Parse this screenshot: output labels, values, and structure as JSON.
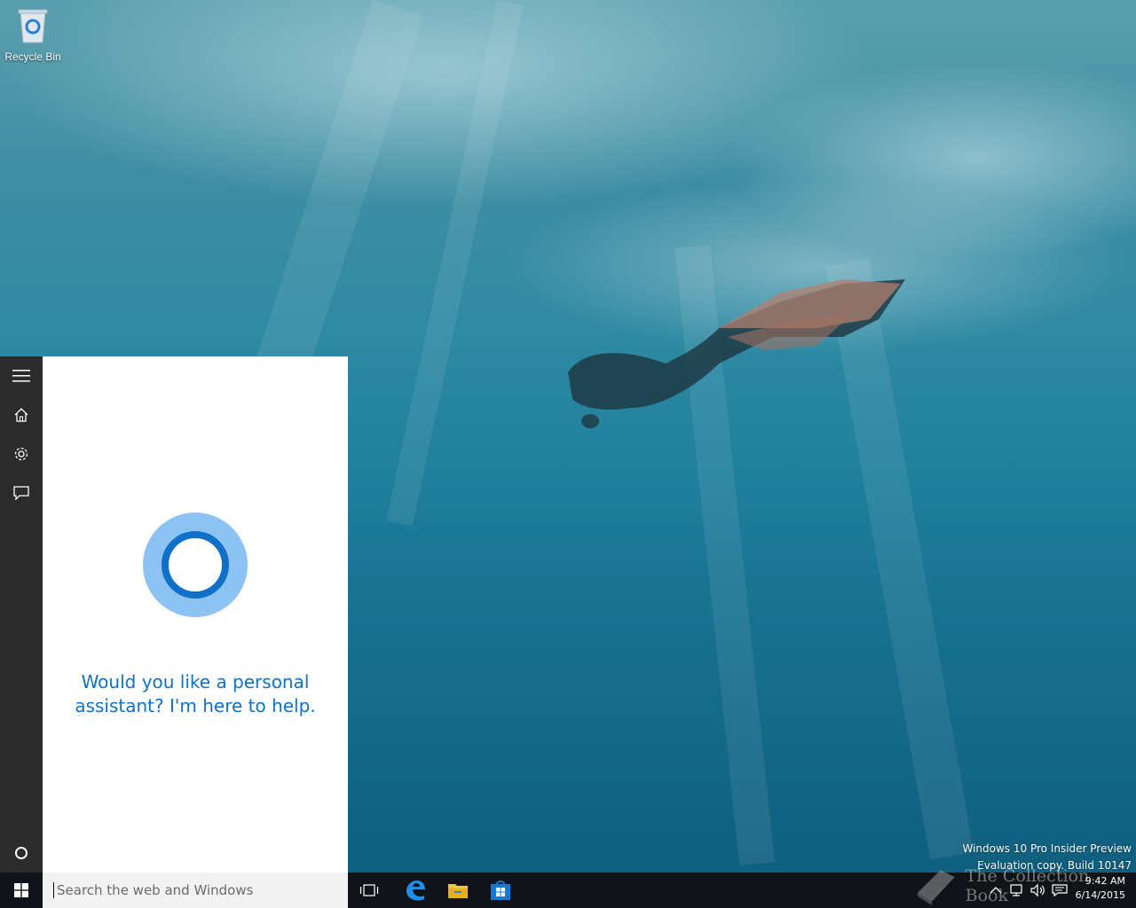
{
  "desktop": {
    "recycle_bin_label": "Recycle Bin"
  },
  "cortana": {
    "message": "Would you like a personal assistant? I'm here to help.",
    "rail": {
      "menu_icon": "hamburger-icon",
      "home_icon": "home-icon",
      "settings_icon": "gear-icon",
      "feedback_icon": "feedback-icon",
      "cortana_icon": "cortana-circle-icon"
    },
    "accent_color": "#0f72c4"
  },
  "search": {
    "placeholder": "Search the web and Windows"
  },
  "taskbar": {
    "apps": [
      {
        "name": "Task View",
        "icon": "task-view-icon"
      },
      {
        "name": "Microsoft Edge",
        "icon": "edge-icon"
      },
      {
        "name": "File Explorer",
        "icon": "folder-icon"
      },
      {
        "name": "Store",
        "icon": "store-icon"
      }
    ],
    "tray_icons": [
      "chevron-up-icon",
      "network-icon",
      "volume-icon",
      "action-center-icon"
    ]
  },
  "watermark": {
    "line1": "Windows 10 Pro Insider Preview",
    "line2": "Evaluation copy. Build 10147"
  },
  "overlay": {
    "text": "The Collection Book"
  },
  "clock": {
    "time": "9:42 AM",
    "date": "6/14/2015"
  }
}
